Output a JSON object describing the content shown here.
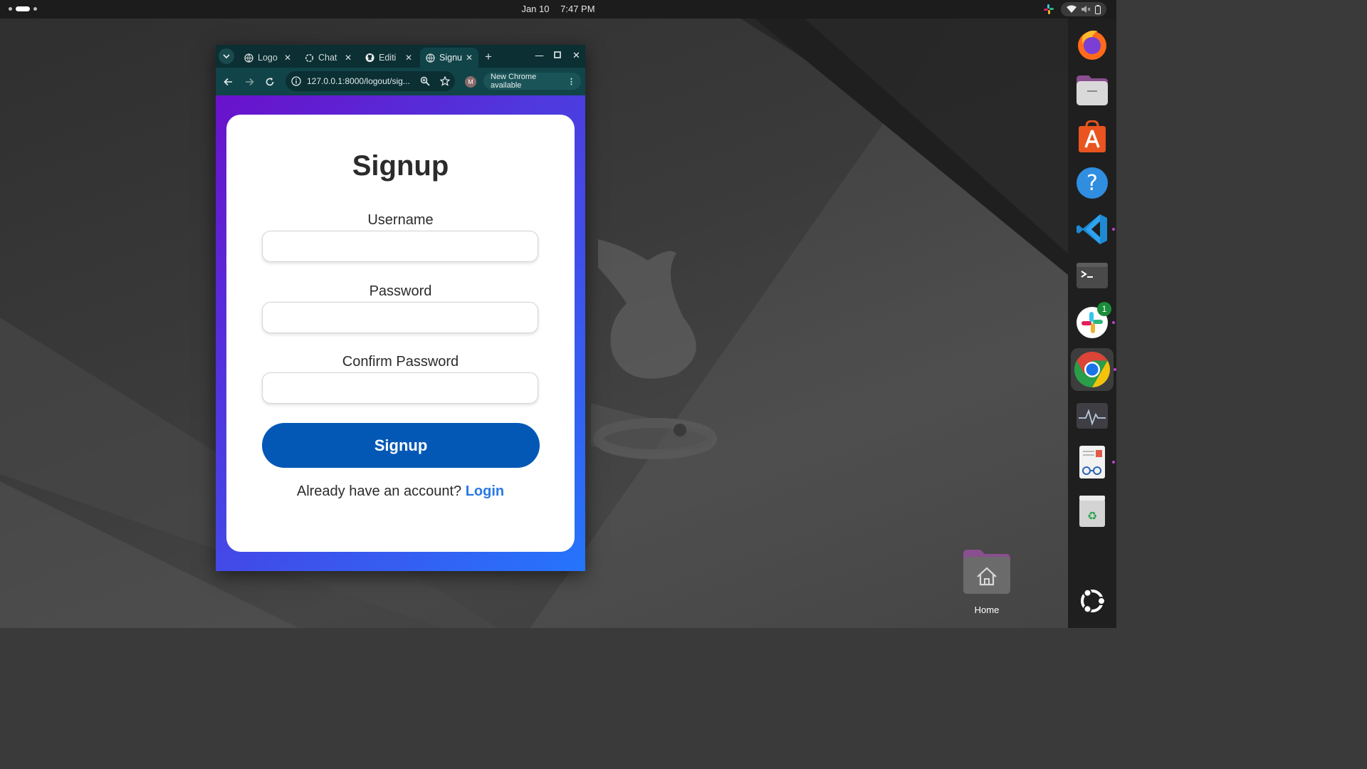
{
  "topbar": {
    "date": "Jan 10",
    "time": "7:47 PM"
  },
  "browser": {
    "tabs": [
      {
        "label": "Logo",
        "icon": "globe-icon",
        "active": false
      },
      {
        "label": "Chat",
        "icon": "openai-icon",
        "active": false
      },
      {
        "label": "Editi",
        "icon": "github-icon",
        "active": false
      },
      {
        "label": "Signu",
        "icon": "globe-icon",
        "active": true
      }
    ],
    "url": "127.0.0.1:8000/logout/sig...",
    "avatar_initial": "M",
    "update_chip": "New Chrome available"
  },
  "signup": {
    "title": "Signup",
    "username_label": "Username",
    "password_label": "Password",
    "confirm_label": "Confirm Password",
    "submit_label": "Signup",
    "login_prompt": "Already have an account?",
    "login_link": "Login"
  },
  "dock": {
    "items": [
      "firefox-icon",
      "files-icon",
      "app-center-icon",
      "help-icon",
      "vscode-icon",
      "terminal-icon",
      "slack-icon",
      "chrome-icon",
      "system-monitor-icon",
      "document-viewer-icon",
      "trash-icon"
    ],
    "slack_badge": "1",
    "show_apps": "ubuntu-icon"
  },
  "desktop": {
    "home_label": "Home"
  },
  "colors": {
    "gradient_start": "#6a11cb",
    "gradient_end": "#2575fc",
    "signup_button": "#0358b6",
    "login_link": "#2a78e4",
    "browser_frame": "#114448"
  }
}
